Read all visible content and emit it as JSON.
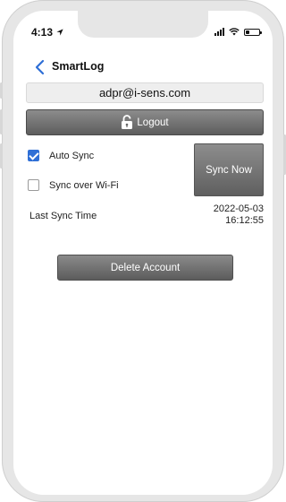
{
  "status_bar": {
    "time": "4:13",
    "icons": [
      "location-arrow-icon",
      "cellular-signal-icon",
      "wifi-icon",
      "battery-icon"
    ]
  },
  "nav": {
    "back_icon": "chevron-left-icon",
    "title": "SmartLog"
  },
  "account": {
    "email": "adpr@i-sens.com",
    "logout_label": "Logout",
    "logout_icon": "unlock-icon"
  },
  "sync": {
    "auto_sync_label": "Auto Sync",
    "auto_sync_checked": true,
    "wifi_only_label": "Sync over Wi-Fi",
    "wifi_only_checked": false,
    "sync_now_label": "Sync Now",
    "last_sync_label": "Last Sync Time",
    "last_sync_date": "2022-05-03",
    "last_sync_time": "16:12:55"
  },
  "danger": {
    "delete_account_label": "Delete Account"
  },
  "colors": {
    "accent_blue": "#2f6fd6",
    "button_gray_top": "#8c8c8c",
    "button_gray_bottom": "#5d5d5d"
  }
}
